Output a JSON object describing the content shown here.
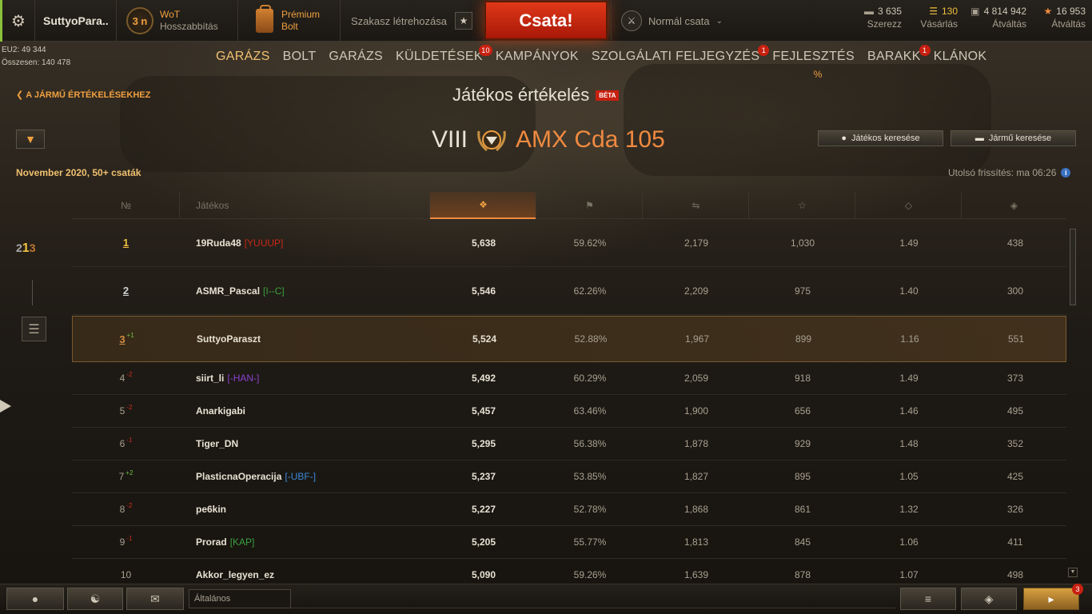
{
  "topbar": {
    "username": "SuttyoPara..",
    "wot_badge": "3 n",
    "wot_line1": "WoT",
    "wot_line2": "Hosszabbítás",
    "premium_line1": "Prémium",
    "premium_line2": "Bolt",
    "platoon_label": "Szakasz létrehozása",
    "battle_button": "Csata!",
    "battle_mode": "Normál csata",
    "currencies": [
      {
        "icon": "bond-icon",
        "value": "3 635",
        "label": "Szerezz"
      },
      {
        "icon": "gold-icon",
        "value": "130",
        "label": "Vásárlás"
      },
      {
        "icon": "credits-icon",
        "value": "4 814 942",
        "label": "Átváltás"
      },
      {
        "icon": "free-xp-icon",
        "value": "16 953",
        "label": "Átváltás"
      }
    ]
  },
  "server": {
    "line1": "EU2: 49 344",
    "line2": "Összesen: 140 478"
  },
  "nav": {
    "items": [
      {
        "label": "GARÁZS",
        "active": true
      },
      {
        "label": "BOLT"
      },
      {
        "label": "GARÁZS"
      },
      {
        "label": "KÜLDETÉSEK",
        "badge": "10"
      },
      {
        "label": "KAMPÁNYOK"
      },
      {
        "label": "SZOLGÁLATI FELJEGYZÉS",
        "badge": "1"
      },
      {
        "label": "FEJLESZTÉS",
        "sub": "%"
      },
      {
        "label": "BARAKK",
        "badge": "1"
      },
      {
        "label": "KLÁNOK"
      }
    ]
  },
  "header": {
    "back_link": "A JÁRMŰ ÉRTÉKELÉSEKHEZ",
    "title": "Játékos értékelés",
    "beta": "BÉTA",
    "tier": "VIII",
    "vehicle": "AMX Cda 105",
    "period": "November 2020, 50+ csaták",
    "search_player": "Játékos keresése",
    "search_vehicle": "Jármű keresése",
    "last_update": "Utolsó frissítés: ma 06:26"
  },
  "table": {
    "col_rank": "№",
    "col_player": "Játékos",
    "col_icons": [
      "rating-icon",
      "win-flag-icon",
      "damage-icon",
      "xp-star-icon",
      "kills-icon",
      "assist-icon"
    ],
    "rows": [
      {
        "rank": "1",
        "change": "",
        "name": "19Ruda48",
        "clan": "[YUUUP]",
        "clan_color": "#c82818",
        "score": "5,638",
        "wr": "59.62%",
        "dmg": "2,179",
        "xp": "1,030",
        "kd": "1.49",
        "ast": "438"
      },
      {
        "rank": "2",
        "change": "",
        "name": "ASMR_Pascal",
        "clan": "[I--C]",
        "clan_color": "#3aa040",
        "score": "5,546",
        "wr": "62.26%",
        "dmg": "2,209",
        "xp": "975",
        "kd": "1.40",
        "ast": "300"
      },
      {
        "rank": "3",
        "change": "+1",
        "name": "SuttyoParaszt",
        "clan": "",
        "clan_color": "",
        "score": "5,524",
        "wr": "52.88%",
        "dmg": "1,967",
        "xp": "899",
        "kd": "1.16",
        "ast": "551"
      },
      {
        "rank": "4",
        "change": "-2",
        "name": "siirt_li",
        "clan": "[-HAN-]",
        "clan_color": "#8a40d0",
        "score": "5,492",
        "wr": "60.29%",
        "dmg": "2,059",
        "xp": "918",
        "kd": "1.49",
        "ast": "373"
      },
      {
        "rank": "5",
        "change": "-2",
        "name": "Anarkigabi",
        "clan": "",
        "clan_color": "",
        "score": "5,457",
        "wr": "63.46%",
        "dmg": "1,900",
        "xp": "656",
        "kd": "1.46",
        "ast": "495"
      },
      {
        "rank": "6",
        "change": "-1",
        "name": "Tiger_DN",
        "clan": "",
        "clan_color": "",
        "score": "5,295",
        "wr": "56.38%",
        "dmg": "1,878",
        "xp": "929",
        "kd": "1.48",
        "ast": "352"
      },
      {
        "rank": "7",
        "change": "+2",
        "name": "PlasticnaOperacija",
        "clan": "[-UBF-]",
        "clan_color": "#3a8ad8",
        "score": "5,237",
        "wr": "53.85%",
        "dmg": "1,827",
        "xp": "895",
        "kd": "1.05",
        "ast": "425"
      },
      {
        "rank": "8",
        "change": "-2",
        "name": "pe6kin",
        "clan": "",
        "clan_color": "",
        "score": "5,227",
        "wr": "52.78%",
        "dmg": "1,868",
        "xp": "861",
        "kd": "1.32",
        "ast": "326"
      },
      {
        "rank": "9",
        "change": "-1",
        "name": "Prorad",
        "clan": "[KAP]",
        "clan_color": "#3aa040",
        "score": "5,205",
        "wr": "55.77%",
        "dmg": "1,813",
        "xp": "845",
        "kd": "1.06",
        "ast": "411"
      },
      {
        "rank": "10",
        "change": "",
        "name": "Akkor_legyen_ez",
        "clan": "",
        "clan_color": "",
        "score": "5,090",
        "wr": "59.26%",
        "dmg": "1,639",
        "xp": "878",
        "kd": "1.07",
        "ast": "498"
      }
    ]
  },
  "bottom": {
    "chat_channel": "Általános",
    "notifications": "3"
  },
  "colors": {
    "accent": "#f08a40",
    "battle": "#c82010",
    "gold": "#f0c070"
  }
}
